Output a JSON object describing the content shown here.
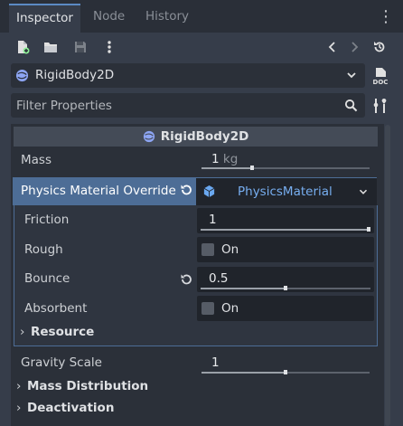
{
  "tabs": [
    {
      "label": "Inspector",
      "active": true
    },
    {
      "label": "Node",
      "active": false
    },
    {
      "label": "History",
      "active": false
    }
  ],
  "icons": {
    "tab_menu": "vertical-ellipsis-icon",
    "new_resource": "new-resource-icon",
    "open": "folder-open-icon",
    "save": "save-icon",
    "more": "vertical-ellipsis-icon",
    "back": "chevron-left-icon",
    "forward": "chevron-right-icon",
    "history": "history-icon",
    "node": "rigidbody-icon",
    "dropdown": "chevron-down-icon",
    "doc": "documentation-icon",
    "search": "search-icon",
    "tools": "tools-icon",
    "revert": "revert-icon",
    "resource": "cube-icon"
  },
  "object_selector": {
    "label": "RigidBody2D"
  },
  "filter": {
    "placeholder": "Filter Properties",
    "value": ""
  },
  "class_header": {
    "label": "RigidBody2D"
  },
  "mass": {
    "label": "Mass",
    "value": "1",
    "unit": "kg",
    "slider": 0.3
  },
  "physics_material_override": {
    "label": "Physics Material Override",
    "resource": "PhysicsMaterial"
  },
  "friction": {
    "label": "Friction",
    "value": "1",
    "slider": 1.0
  },
  "rough": {
    "label": "Rough",
    "checkbox_label": "On",
    "checked": false
  },
  "bounce": {
    "label": "Bounce",
    "value": "0.5",
    "slider": 0.5
  },
  "absorbent": {
    "label": "Absorbent",
    "checkbox_label": "On",
    "checked": false
  },
  "resource_section": {
    "label": "Resource"
  },
  "gravity_scale": {
    "label": "Gravity Scale",
    "value": "1",
    "slider": 0.5
  },
  "sections": [
    {
      "label": "Mass Distribution"
    },
    {
      "label": "Deactivation"
    }
  ],
  "colors": {
    "accent": "#5b8ac4",
    "override_row": "#4d6d96",
    "resource_link": "#77aef0",
    "background": "#363d4a",
    "field": "#20242b"
  }
}
